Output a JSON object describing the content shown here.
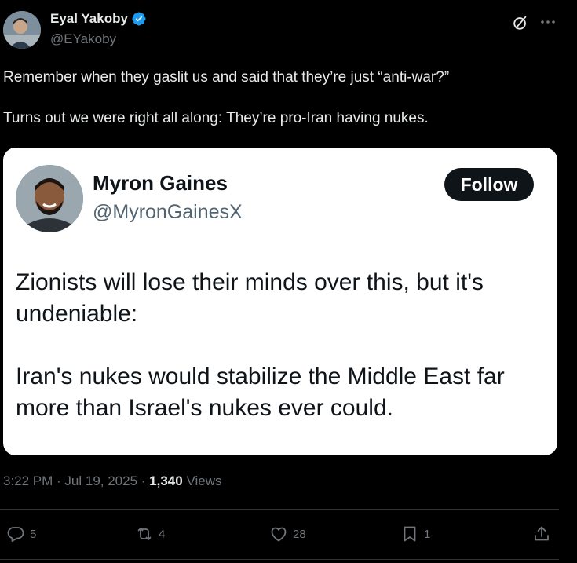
{
  "author": {
    "display_name": "Eyal Yakoby",
    "handle": "@EYakoby",
    "verified": true
  },
  "tweet": {
    "paragraphs": [
      "Remember when they gaslit us and said that they’re just “anti-war?”",
      "Turns out we were right all along: They’re pro-Iran having nukes."
    ]
  },
  "quoted": {
    "display_name": "Myron Gaines",
    "handle": "@MyronGainesX",
    "follow_label": "Follow",
    "paragraphs": [
      "Zionists will lose their minds over this, but it's undeniable:",
      "Iran's nukes would stabilize the Middle East far more than Israel's nukes ever could."
    ]
  },
  "meta": {
    "time": "3:22 PM",
    "separator": " · ",
    "date": "Jul 19, 2025",
    "views_count": "1,340",
    "views_label": " Views"
  },
  "actions": {
    "replies": "5",
    "reposts": "4",
    "likes": "28",
    "bookmarks": "1"
  },
  "colors": {
    "background": "#000000",
    "text": "#e7e9ea",
    "muted": "#71767b",
    "verified_blue": "#1d9bf0",
    "card_bg": "#ffffff",
    "follow_bg": "#0f1419"
  },
  "icons": [
    "verified-badge-icon",
    "grok-icon",
    "more-icon",
    "reply-icon",
    "repost-icon",
    "like-icon",
    "bookmark-icon",
    "share-icon"
  ]
}
